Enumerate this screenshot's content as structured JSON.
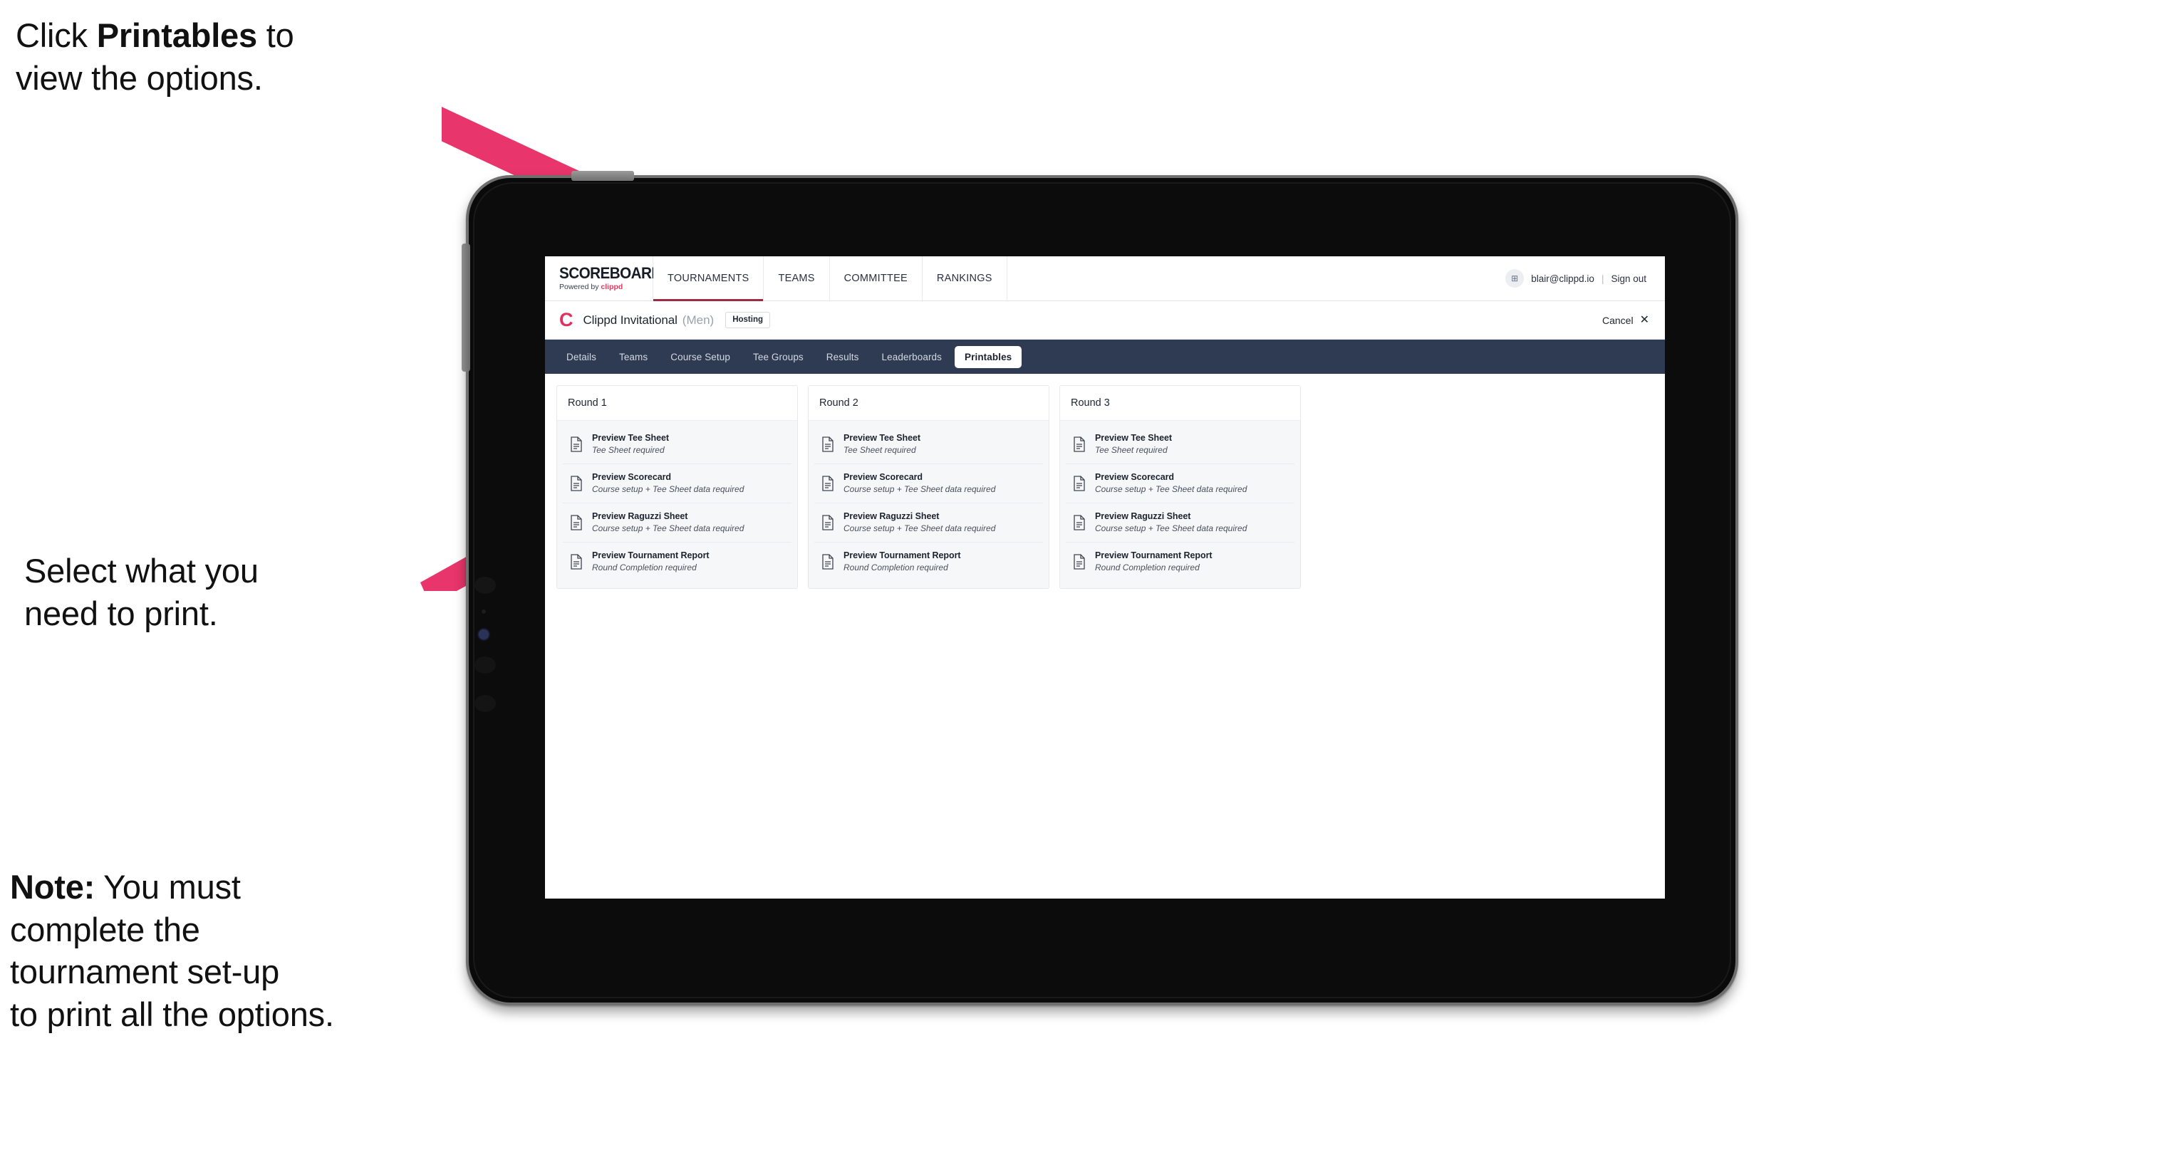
{
  "annotations": [
    {
      "id": "click",
      "html": "Click <b>Printables</b> to\nview the options."
    },
    {
      "id": "select",
      "html": "Select what you\n need to print."
    },
    {
      "id": "note",
      "html": "<b>Note:</b> You must\ncomplete the\ntournament set-up\nto print all the options."
    }
  ],
  "colors": {
    "arrow": "#E8356B",
    "tabstrip_bg": "#2F3B52",
    "brand_accent": "#E13A63",
    "tournament_logo": "#E0315C",
    "active_tab_underline": "#9E2B45"
  },
  "topnav": {
    "brand_title": "SCOREBOARD",
    "brand_sub_prefix": "Powered by ",
    "brand_sub_accent": "clippd",
    "tabs": [
      {
        "label": "TOURNAMENTS",
        "active": true
      },
      {
        "label": "TEAMS",
        "active": false
      },
      {
        "label": "COMMITTEE",
        "active": false
      },
      {
        "label": "RANKINGS",
        "active": false
      }
    ],
    "avatar_glyph": "⊞",
    "user_email": "blair@clippd.io",
    "separator": "|",
    "signout_label": "Sign out"
  },
  "tournament_bar": {
    "logo_letter": "C",
    "name": "Clippd Invitational",
    "gender": "(Men)",
    "badge": "Hosting",
    "cancel_label": "Cancel",
    "cancel_icon": "✕"
  },
  "section_tabs": [
    {
      "label": "Details",
      "active": false
    },
    {
      "label": "Teams",
      "active": false
    },
    {
      "label": "Course Setup",
      "active": false
    },
    {
      "label": "Tee Groups",
      "active": false
    },
    {
      "label": "Results",
      "active": false
    },
    {
      "label": "Leaderboards",
      "active": false
    },
    {
      "label": "Printables",
      "active": true
    }
  ],
  "rounds": [
    {
      "title": "Round 1",
      "items": [
        {
          "title": "Preview Tee Sheet",
          "sub": "Tee Sheet required"
        },
        {
          "title": "Preview Scorecard",
          "sub": "Course setup + Tee Sheet data required"
        },
        {
          "title": "Preview Raguzzi Sheet",
          "sub": "Course setup + Tee Sheet data required"
        },
        {
          "title": "Preview Tournament Report",
          "sub": "Round Completion required"
        }
      ]
    },
    {
      "title": "Round 2",
      "items": [
        {
          "title": "Preview Tee Sheet",
          "sub": "Tee Sheet required"
        },
        {
          "title": "Preview Scorecard",
          "sub": "Course setup + Tee Sheet data required"
        },
        {
          "title": "Preview Raguzzi Sheet",
          "sub": "Course setup + Tee Sheet data required"
        },
        {
          "title": "Preview Tournament Report",
          "sub": "Round Completion required"
        }
      ]
    },
    {
      "title": "Round 3",
      "items": [
        {
          "title": "Preview Tee Sheet",
          "sub": "Tee Sheet required"
        },
        {
          "title": "Preview Scorecard",
          "sub": "Course setup + Tee Sheet data required"
        },
        {
          "title": "Preview Raguzzi Sheet",
          "sub": "Course setup + Tee Sheet data required"
        },
        {
          "title": "Preview Tournament Report",
          "sub": "Round Completion required"
        }
      ]
    }
  ]
}
